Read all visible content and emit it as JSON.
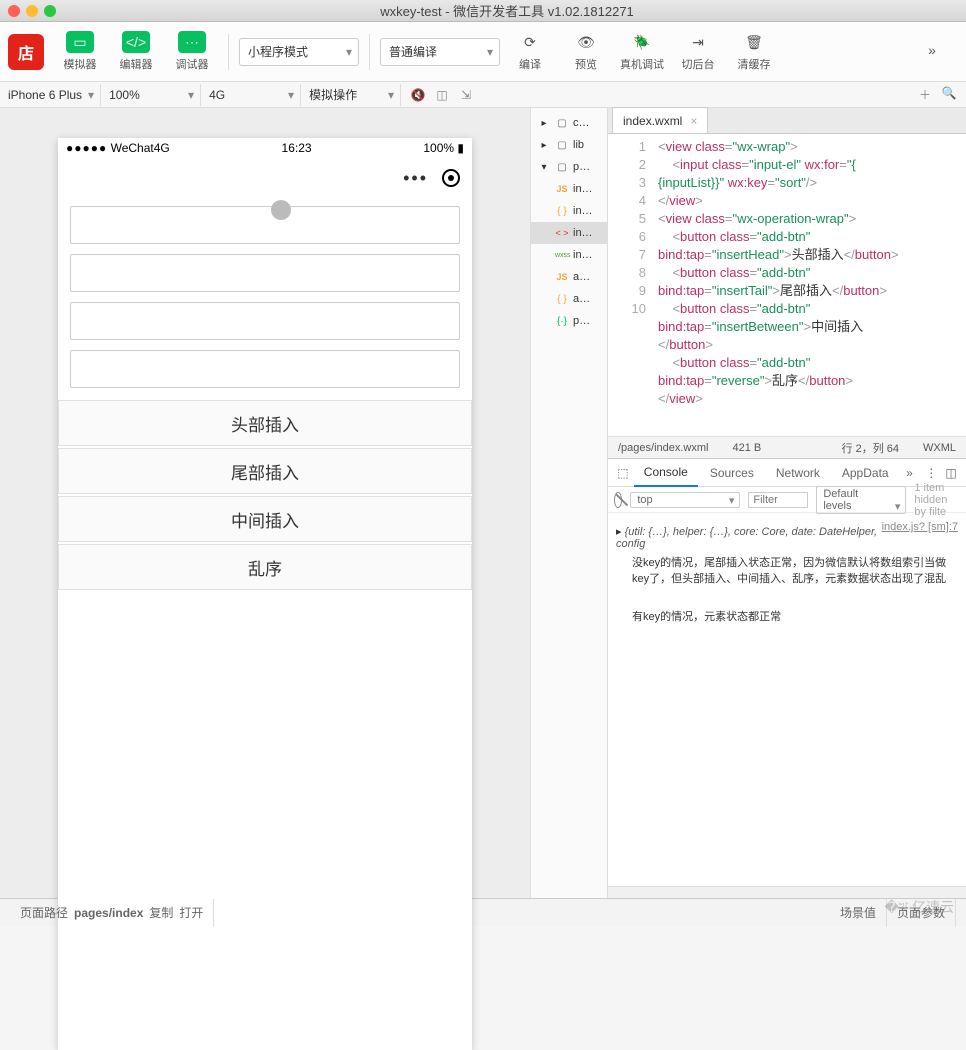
{
  "window": {
    "title": "wxkey-test - 微信开发者工具 v1.02.1812271"
  },
  "toolbar": {
    "simulator": "模拟器",
    "editor": "编辑器",
    "debugger": "调试器",
    "mode": "小程序模式",
    "compile_mode": "普通编译",
    "compile": "编译",
    "preview": "预览",
    "remote_debug": "真机调试",
    "background": "切后台",
    "clear_cache": "清缓存"
  },
  "secbar": {
    "device": "iPhone 6 Plus",
    "zoom": "100%",
    "network": "4G",
    "sim_action": "模拟操作"
  },
  "phone": {
    "carrier": "WeChat",
    "signal": "●●●●●",
    "net": "4G",
    "time": "16:23",
    "battery": "100%",
    "buttons": [
      "头部插入",
      "尾部插入",
      "中间插入",
      "乱序"
    ]
  },
  "filetree": {
    "items": [
      {
        "icon": "▸",
        "type": "folder",
        "label": "c…"
      },
      {
        "icon": "▸",
        "type": "folder",
        "label": "lib"
      },
      {
        "icon": "▾",
        "type": "folder",
        "label": "p…"
      },
      {
        "icon": "",
        "type": "js",
        "label": "in…"
      },
      {
        "icon": "",
        "type": "json",
        "label": "in…"
      },
      {
        "icon": "",
        "type": "wxml",
        "label": "in…",
        "sel": true
      },
      {
        "icon": "",
        "type": "wxss",
        "label": "in…"
      },
      {
        "icon": "",
        "type": "js",
        "label": "a…"
      },
      {
        "icon": "",
        "type": "json",
        "label": "a…"
      },
      {
        "icon": "",
        "type": "proj",
        "label": "p…"
      }
    ]
  },
  "editor": {
    "tab": "index.wxml",
    "lines": [
      "1",
      "2",
      "3",
      "4",
      "5",
      "6",
      "7",
      "8",
      "9",
      "10"
    ],
    "code_tokens": [
      [
        [
          "<",
          "pun"
        ],
        [
          "view",
          "tag"
        ],
        [
          " ",
          ""
        ],
        [
          "class",
          "attr"
        ],
        [
          "=",
          "pun"
        ],
        [
          "\"wx-wrap\"",
          "str"
        ],
        [
          ">",
          "pun"
        ]
      ],
      [
        [
          "    ",
          ""
        ],
        [
          "<",
          "pun"
        ],
        [
          "input",
          "tag"
        ],
        [
          " ",
          ""
        ],
        [
          "class",
          "attr"
        ],
        [
          "=",
          "pun"
        ],
        [
          "\"input-el\"",
          "str"
        ],
        [
          " ",
          ""
        ],
        [
          "wx:for",
          "attr"
        ],
        [
          "=",
          "pun"
        ],
        [
          "\"{",
          "str"
        ]
      ],
      [
        [
          "{inputList}}\"",
          "str"
        ],
        [
          " ",
          ""
        ],
        [
          "wx:key",
          "attr"
        ],
        [
          "=",
          "pun"
        ],
        [
          "\"sort\"",
          "str"
        ],
        [
          "/>",
          "pun"
        ]
      ],
      [
        [
          "</",
          "pun"
        ],
        [
          "view",
          "tag"
        ],
        [
          ">",
          "pun"
        ]
      ],
      [
        [
          "<",
          "pun"
        ],
        [
          "view",
          "tag"
        ],
        [
          " ",
          ""
        ],
        [
          "class",
          "attr"
        ],
        [
          "=",
          "pun"
        ],
        [
          "\"wx-operation-wrap\"",
          "str"
        ],
        [
          ">",
          "pun"
        ]
      ],
      [
        [
          "    ",
          ""
        ],
        [
          "<",
          "pun"
        ],
        [
          "button",
          "tag"
        ],
        [
          " ",
          ""
        ],
        [
          "class",
          "attr"
        ],
        [
          "=",
          "pun"
        ],
        [
          "\"add-btn\"",
          "str"
        ]
      ],
      [
        [
          "bind:tap",
          "attr"
        ],
        [
          "=",
          "pun"
        ],
        [
          "\"insertHead\"",
          "str"
        ],
        [
          ">",
          "pun"
        ],
        [
          "头部插入",
          "text"
        ],
        [
          "</",
          "pun"
        ],
        [
          "button",
          "tag"
        ],
        [
          ">",
          "pun"
        ]
      ],
      [
        [
          "    ",
          ""
        ],
        [
          "<",
          "pun"
        ],
        [
          "button",
          "tag"
        ],
        [
          " ",
          ""
        ],
        [
          "class",
          "attr"
        ],
        [
          "=",
          "pun"
        ],
        [
          "\"add-btn\"",
          "str"
        ]
      ],
      [
        [
          "bind:tap",
          "attr"
        ],
        [
          "=",
          "pun"
        ],
        [
          "\"insertTail\"",
          "str"
        ],
        [
          ">",
          "pun"
        ],
        [
          "尾部插入",
          "text"
        ],
        [
          "</",
          "pun"
        ],
        [
          "button",
          "tag"
        ],
        [
          ">",
          "pun"
        ]
      ],
      [
        [
          "    ",
          ""
        ],
        [
          "<",
          "pun"
        ],
        [
          "button",
          "tag"
        ],
        [
          " ",
          ""
        ],
        [
          "class",
          "attr"
        ],
        [
          "=",
          "pun"
        ],
        [
          "\"add-btn\"",
          "str"
        ]
      ],
      [
        [
          "bind:tap",
          "attr"
        ],
        [
          "=",
          "pun"
        ],
        [
          "\"insertBetween\"",
          "str"
        ],
        [
          ">",
          "pun"
        ],
        [
          "中间插入",
          "text"
        ]
      ],
      [
        [
          "</",
          "pun"
        ],
        [
          "button",
          "tag"
        ],
        [
          ">",
          "pun"
        ]
      ],
      [
        [
          "    ",
          ""
        ],
        [
          "<",
          "pun"
        ],
        [
          "button",
          "tag"
        ],
        [
          " ",
          ""
        ],
        [
          "class",
          "attr"
        ],
        [
          "=",
          "pun"
        ],
        [
          "\"add-btn\"",
          "str"
        ]
      ],
      [
        [
          "bind:tap",
          "attr"
        ],
        [
          "=",
          "pun"
        ],
        [
          "\"reverse\"",
          "str"
        ],
        [
          ">",
          "pun"
        ],
        [
          "乱序",
          "text"
        ],
        [
          "</",
          "pun"
        ],
        [
          "button",
          "tag"
        ],
        [
          ">",
          "pun"
        ]
      ],
      [
        [
          "</",
          "pun"
        ],
        [
          "view",
          "tag"
        ],
        [
          ">",
          "pun"
        ]
      ],
      [
        [
          "",
          ""
        ]
      ]
    ],
    "status_path": "/pages/index.wxml",
    "status_size": "421 B",
    "status_pos": "行 2，列 64",
    "status_lang": "WXML"
  },
  "console": {
    "tabs": [
      "Console",
      "Sources",
      "Network",
      "AppData"
    ],
    "context": "top",
    "filter_ph": "Filter",
    "levels": "Default levels",
    "hidden": "1 item hidden by filte",
    "source": "index.js? [sm]:7",
    "obj": "{util: {…}, helper: {…}, core: Core, date: DateHelper, config",
    "msg1": "没key的情况，尾部插入状态正常，因为微信默认将数组索引当做key了，但头部插入、中间插入、乱序，元素数据状态出现了混乱",
    "msg2": "有key的情况，元素状态都正常"
  },
  "footer": {
    "route_label": "页面路径",
    "route_value": "pages/index",
    "copy": "复制",
    "open": "打开",
    "scene": "场景值",
    "params": "页面参数"
  }
}
